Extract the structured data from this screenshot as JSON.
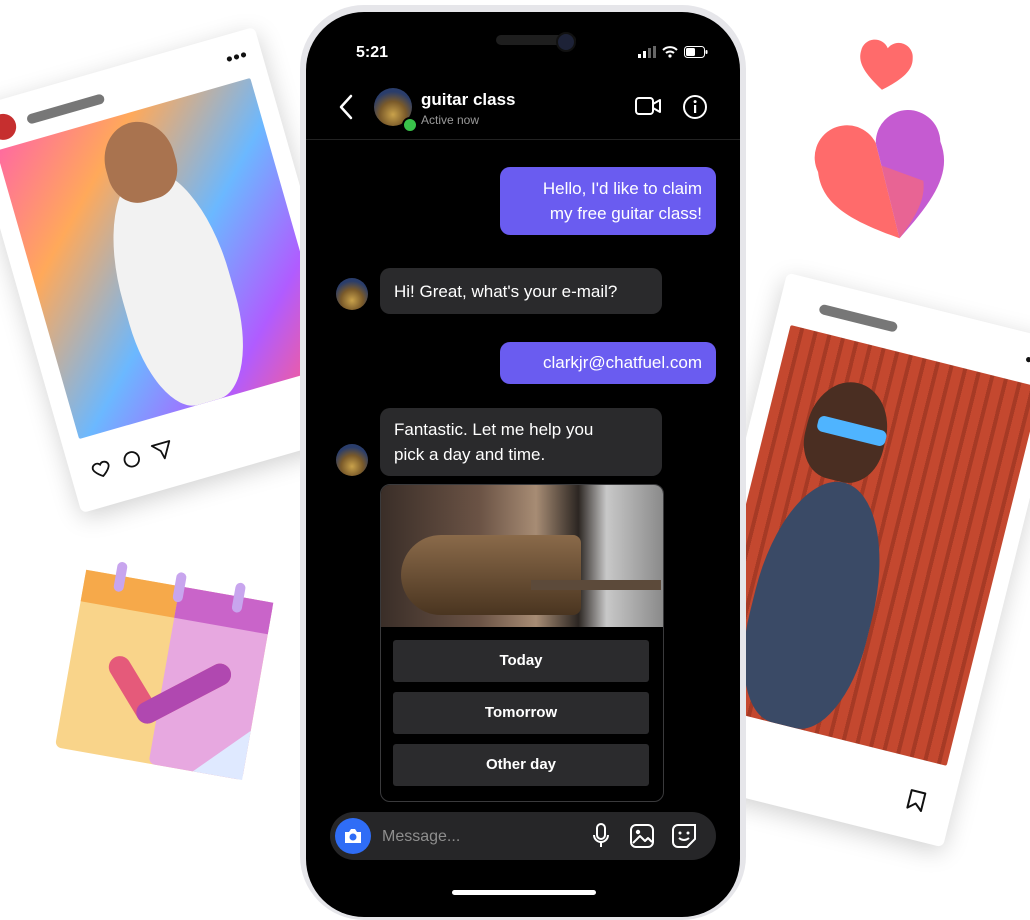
{
  "status_bar": {
    "time": "5:21"
  },
  "header": {
    "title": "guitar class",
    "subtitle": "Active now"
  },
  "messages": [
    {
      "direction": "outgoing",
      "lines": [
        "Hello, I'd like to claim",
        "my free guitar class!"
      ]
    },
    {
      "direction": "incoming",
      "lines": [
        "Hi! Great, what's your e-mail?"
      ]
    },
    {
      "direction": "outgoing",
      "lines": [
        "clarkjr@chatfuel.com"
      ]
    },
    {
      "direction": "incoming",
      "lines": [
        "Fantastic. Let me help you",
        "pick a day and time."
      ]
    }
  ],
  "quick_replies": [
    "Today",
    "Tomorrow",
    "Other day"
  ],
  "composer": {
    "placeholder": "Message..."
  },
  "colors": {
    "outgoing_bubble": "#6a5cf0",
    "incoming_bubble": "#2a2a2c",
    "camera_button": "#2f6df6",
    "online": "#39c24a"
  },
  "icons": [
    "back-chevron-icon",
    "video-call-icon",
    "info-icon",
    "camera-icon",
    "microphone-icon",
    "gallery-icon",
    "sticker-icon",
    "heart-icon",
    "comment-icon",
    "send-icon",
    "bookmark-icon",
    "calendar-icon"
  ]
}
